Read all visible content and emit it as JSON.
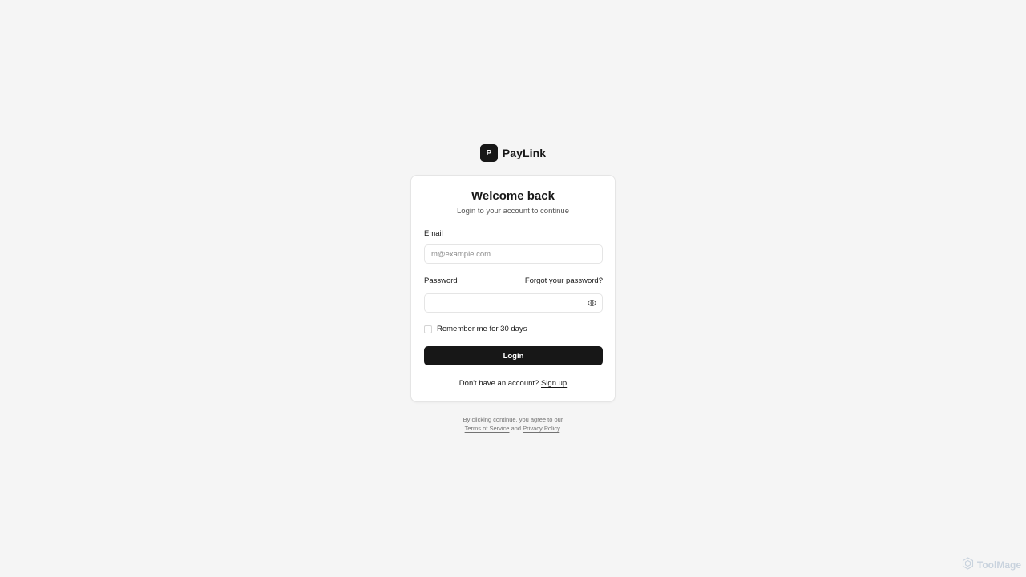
{
  "brand": {
    "logo_letter": "P",
    "name": "PayLink"
  },
  "card": {
    "title": "Welcome back",
    "subtitle": "Login to your account to continue",
    "email": {
      "label": "Email",
      "placeholder": "m@example.com",
      "value": ""
    },
    "password": {
      "label": "Password",
      "forgot_label": "Forgot your password?",
      "value": ""
    },
    "remember_label": "Remember me for 30 days",
    "remember_checked": false,
    "login_label": "Login",
    "signup_prompt": "Don't have an account?",
    "signup_link": "Sign up"
  },
  "legal": {
    "line1": "By clicking continue, you agree to our",
    "terms": "Terms of Service",
    "and": "and",
    "privacy": "Privacy Policy",
    "period": "."
  },
  "watermark": {
    "text": "ToolMage",
    "icon": "hexagon-logo-icon"
  },
  "colors": {
    "background": "#f5f5f5",
    "primary": "#171717",
    "border": "#e5e5e5",
    "muted": "#737373"
  }
}
